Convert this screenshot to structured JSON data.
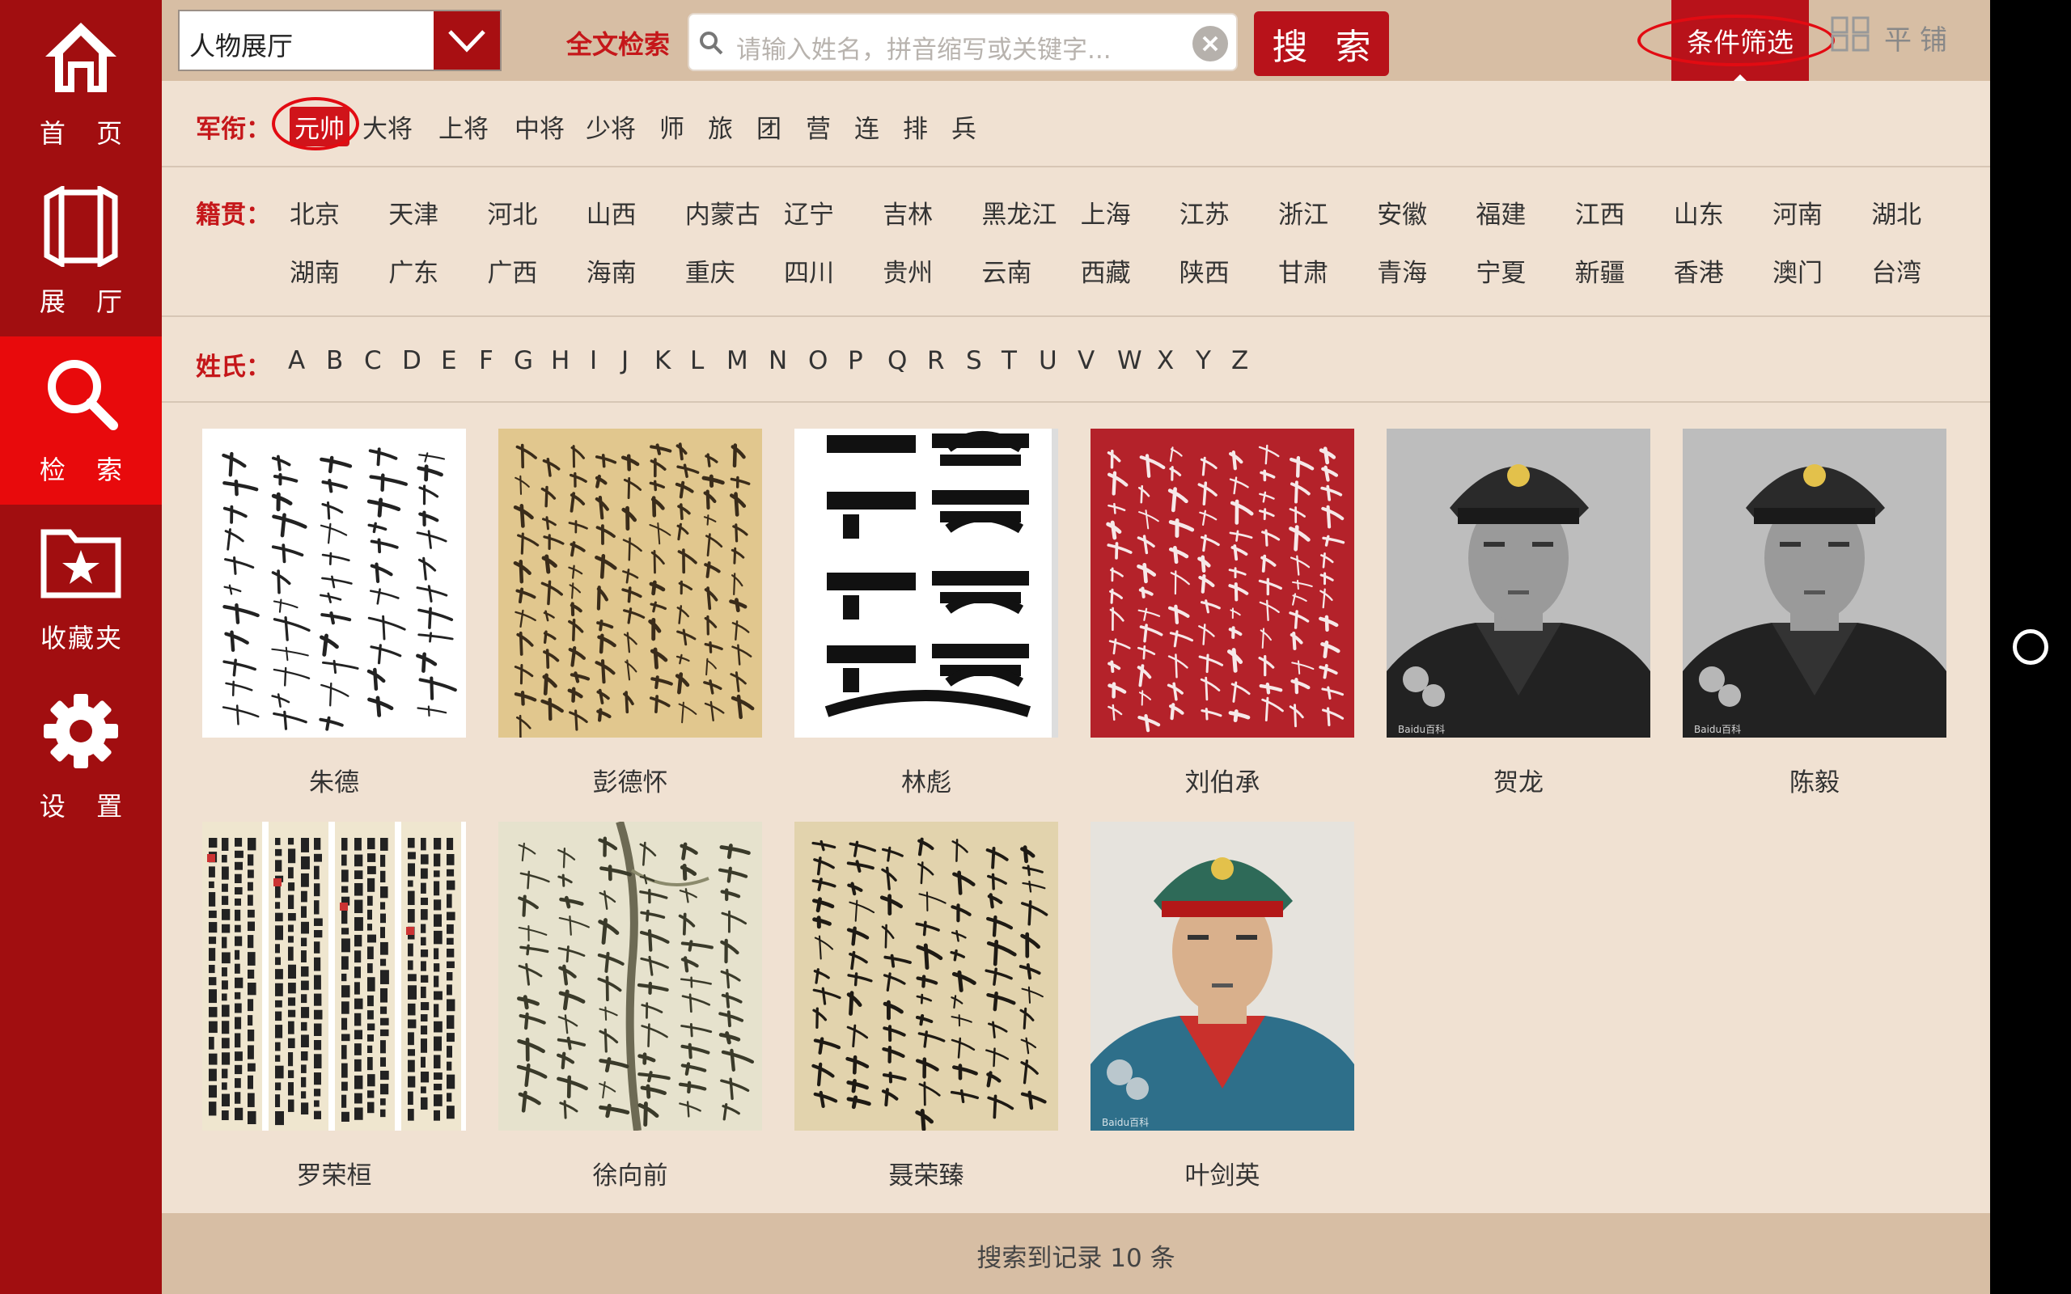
{
  "sidebar": {
    "items": [
      {
        "label": "首 页",
        "icon": "home-icon"
      },
      {
        "label": "展 厅",
        "icon": "hall-icon"
      },
      {
        "label": "检 索",
        "icon": "search-icon"
      },
      {
        "label": "收藏夹",
        "icon": "favorites-folder-icon"
      },
      {
        "label": "设 置",
        "icon": "gear-icon"
      }
    ],
    "active_index": 2
  },
  "topbar": {
    "hall_select_value": "人物展厅",
    "fulltext_label": "全文检索",
    "search_placeholder": "请输入姓名，拼音缩写或关键字...",
    "search_button": "搜 索",
    "filter_button": "条件筛选",
    "tile_button": "平铺"
  },
  "filters": {
    "rank": {
      "label": "军衔：",
      "options": [
        "元帅",
        "大将",
        "上将",
        "中将",
        "少将",
        "师",
        "旅",
        "团",
        "营",
        "连",
        "排",
        "兵"
      ],
      "selected": "元帅"
    },
    "hometown": {
      "label": "籍贯：",
      "options": [
        "北京",
        "天津",
        "河北",
        "山西",
        "内蒙古",
        "辽宁",
        "吉林",
        "黑龙江",
        "上海",
        "江苏",
        "浙江",
        "安徽",
        "福建",
        "江西",
        "山东",
        "河南",
        "湖北",
        "湖南",
        "广东",
        "广西",
        "海南",
        "重庆",
        "四川",
        "贵州",
        "云南",
        "西藏",
        "陕西",
        "甘肃",
        "青海",
        "宁夏",
        "新疆",
        "香港",
        "澳门",
        "台湾"
      ]
    },
    "surname": {
      "label": "姓氏：",
      "options": [
        "A",
        "B",
        "C",
        "D",
        "E",
        "F",
        "G",
        "H",
        "I",
        "J",
        "K",
        "L",
        "M",
        "N",
        "O",
        "P",
        "Q",
        "R",
        "S",
        "T",
        "U",
        "V",
        "W",
        "X",
        "Y",
        "Z"
      ]
    }
  },
  "results": [
    {
      "name": "朱德",
      "type": "calligraphy-white"
    },
    {
      "name": "彭德怀",
      "type": "calligraphy-aged"
    },
    {
      "name": "林彪",
      "type": "calligraphy-bold"
    },
    {
      "name": "刘伯承",
      "type": "calligraphy-red"
    },
    {
      "name": "贺龙",
      "type": "portrait-bw",
      "watermark": "Baidu百科"
    },
    {
      "name": "陈毅",
      "type": "portrait-bw",
      "watermark": "Baidu百科"
    },
    {
      "name": "罗荣桓",
      "type": "calligraphy-panels"
    },
    {
      "name": "徐向前",
      "type": "painting-ink"
    },
    {
      "name": "聂荣臻",
      "type": "calligraphy-aged2"
    },
    {
      "name": "叶剑英",
      "type": "portrait-color",
      "watermark": "Baidu百科"
    }
  ],
  "footer": {
    "status": "搜索到记录 10 条"
  },
  "colors": {
    "accent": "#a10e10",
    "active": "#e80a0c",
    "background": "#f0e1d2",
    "bar": "#d7bea4",
    "label_red": "#c5171a"
  }
}
